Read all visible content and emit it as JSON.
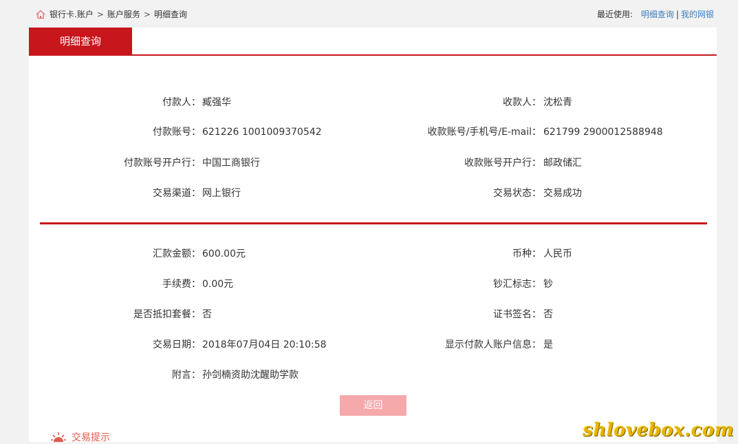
{
  "breadcrumb": {
    "items": [
      "银行卡.账户",
      "账户服务",
      "明细查询"
    ],
    "separator": ">"
  },
  "recent": {
    "label": "最近使用:",
    "links": [
      "明细查询",
      "我的网银"
    ],
    "divider": "|"
  },
  "tab": {
    "label": "明细查询"
  },
  "details_top": {
    "left": [
      {
        "label": "付款人：",
        "value": "臧强华"
      },
      {
        "label": "付款账号：",
        "value": "621226 1001009370542"
      },
      {
        "label": "付款账号开户行：",
        "value": "中国工商银行"
      },
      {
        "label": "交易渠道：",
        "value": "网上银行"
      }
    ],
    "right": [
      {
        "label": "收款人：",
        "value": "沈松青"
      },
      {
        "label": "收款账号/手机号/E-mail：",
        "value": "621799 2900012588948"
      },
      {
        "label": "收款账号开户行：",
        "value": "邮政储汇"
      },
      {
        "label": "交易状态：",
        "value": "交易成功"
      }
    ]
  },
  "details_bottom": {
    "left": [
      {
        "label": "汇款金额：",
        "value": "600.00元"
      },
      {
        "label": "手续费：",
        "value": "0.00元"
      },
      {
        "label": "是否抵扣套餐：",
        "value": "否"
      },
      {
        "label": "交易日期：",
        "value": "2018年07月04日 20:10:58"
      },
      {
        "label": "附言：",
        "value": "孙剑楠资助沈醒助学款"
      }
    ],
    "right": [
      {
        "label": "币种：",
        "value": "人民币"
      },
      {
        "label": "钞汇标志：",
        "value": "钞"
      },
      {
        "label": "证书签名：",
        "value": "否"
      },
      {
        "label": "显示付款人账户信息：",
        "value": "是"
      }
    ]
  },
  "buttons": {
    "back": "返回"
  },
  "tip": {
    "label": "交易提示"
  },
  "watermark": "shlovebox.com",
  "colors": {
    "brand_red": "#c8161d",
    "link_blue": "#3c7fc1",
    "button_pink": "#f5a9ab"
  }
}
